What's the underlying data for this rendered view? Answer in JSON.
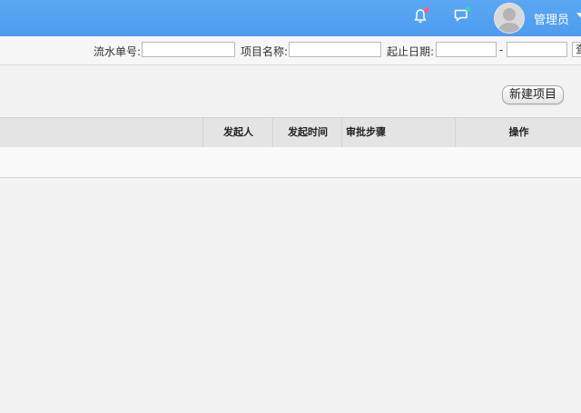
{
  "header": {
    "user_name": "管理员",
    "colors": {
      "bar": "#4e9cf0",
      "bell_badge": "#f0648a",
      "chat_badge": "#3ecfb0"
    },
    "icons": [
      "bell-icon",
      "chat-icon",
      "avatar",
      "chevron-down-icon"
    ]
  },
  "search": {
    "serial_label": "流水单号:",
    "serial_value": "",
    "project_label": "项目名称:",
    "project_value": "",
    "date_label": "起止日期:",
    "date_start": "",
    "date_sep": "-",
    "date_end": "",
    "query_label": "查"
  },
  "actions": {
    "new_project_label": "新建项目"
  },
  "table": {
    "columns": [
      "发起人",
      "发起时间",
      "审批步骤",
      "操作"
    ],
    "rows": []
  }
}
